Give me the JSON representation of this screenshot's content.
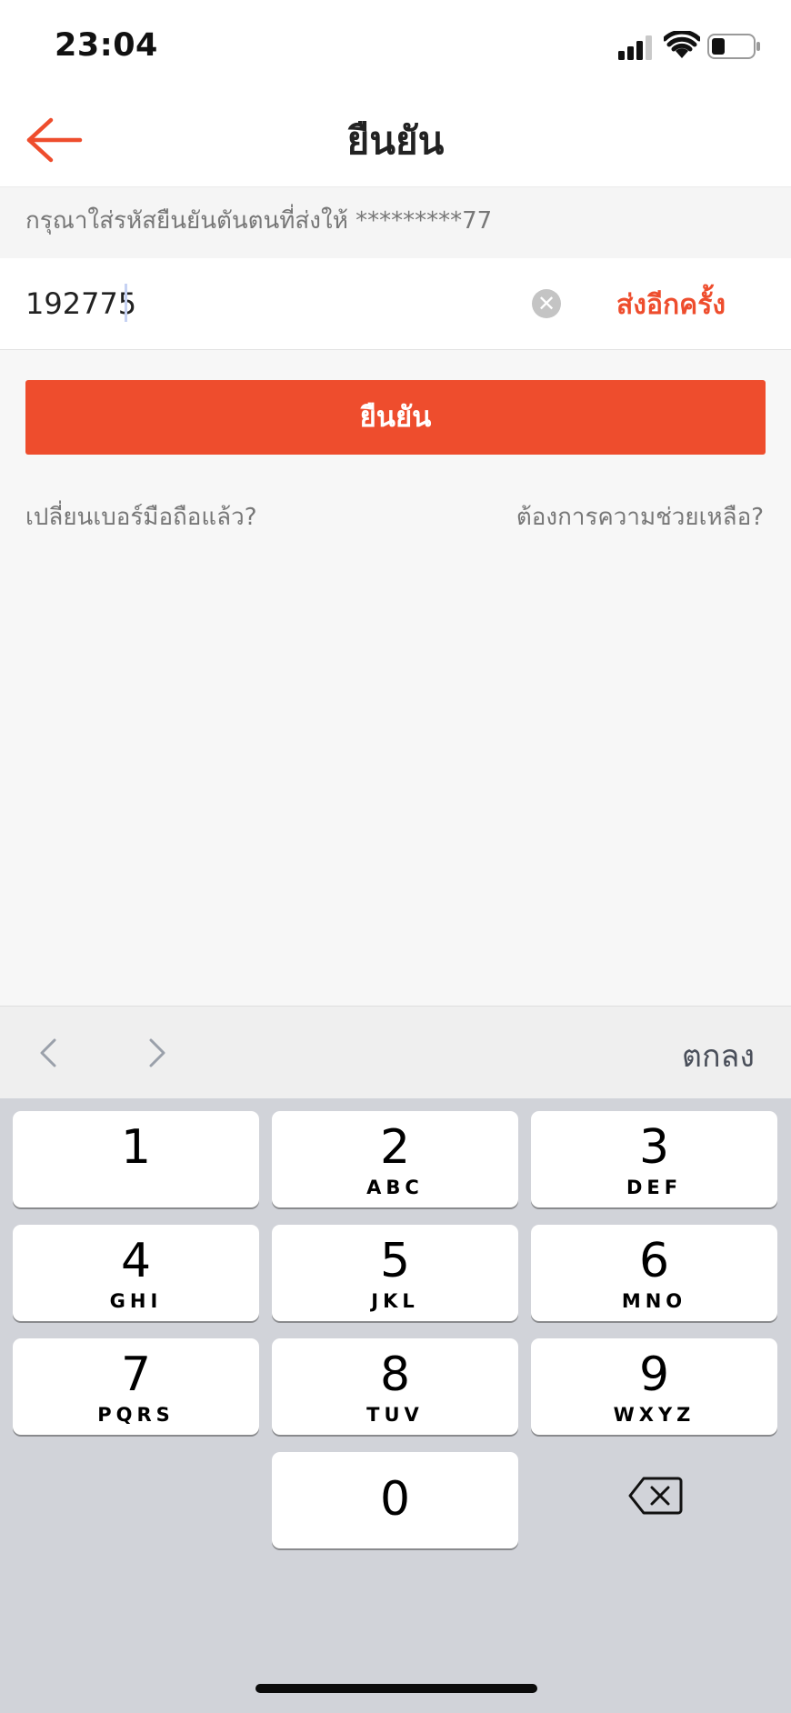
{
  "status_bar": {
    "time": "23:04"
  },
  "header": {
    "title": "ยืนยัน"
  },
  "instruction": {
    "text": "กรุณาใส่รหัสยืนยันตันตนที่ส่งให้ *********77"
  },
  "otp": {
    "value": "192775",
    "resend_label": "ส่งอีกครั้ง"
  },
  "confirm_button": {
    "label": "ยืนยัน"
  },
  "links": {
    "changed_number": "เปลี่ยนเบอร์มือถือแล้ว?",
    "help": "ต้องการความช่วยเหลือ?"
  },
  "keyboard_toolbar": {
    "done_label": "ตกลง"
  },
  "keypad": {
    "keys": [
      {
        "digit": "1",
        "letters": ""
      },
      {
        "digit": "2",
        "letters": "ABC"
      },
      {
        "digit": "3",
        "letters": "DEF"
      },
      {
        "digit": "4",
        "letters": "GHI"
      },
      {
        "digit": "5",
        "letters": "JKL"
      },
      {
        "digit": "6",
        "letters": "MNO"
      },
      {
        "digit": "7",
        "letters": "PQRS"
      },
      {
        "digit": "8",
        "letters": "TUV"
      },
      {
        "digit": "9",
        "letters": "WXYZ"
      },
      {
        "digit": "0",
        "letters": ""
      }
    ]
  },
  "colors": {
    "accent": "#ee4d2d",
    "background": "#f7f7f7",
    "keyboard_bg": "#d1d3d9"
  },
  "icons": [
    "signal-icon",
    "wifi-icon",
    "battery-icon",
    "back-arrow-icon",
    "clear-icon",
    "chevron-left-icon",
    "chevron-right-icon",
    "delete-key-icon"
  ]
}
